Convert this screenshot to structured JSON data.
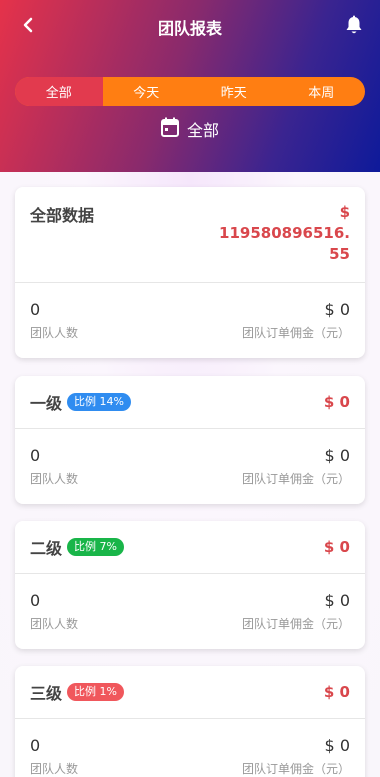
{
  "header": {
    "title": "团队报表",
    "back_icon": "chevron-left-icon",
    "bell_icon": "bell-icon"
  },
  "tabs": [
    {
      "label": "全部",
      "active": true
    },
    {
      "label": "今天",
      "active": false
    },
    {
      "label": "昨天",
      "active": false
    },
    {
      "label": "本周",
      "active": false
    }
  ],
  "date_range": {
    "icon": "calendar-icon",
    "label": "全部"
  },
  "summary": {
    "title": "全部数据",
    "amount_line1": "$",
    "amount_line2": "119580896516.",
    "amount_line3": "55",
    "members_value": "0",
    "members_label": "团队人数",
    "commission_value": "$ 0",
    "commission_label": "团队订单佣金（元）"
  },
  "levels": [
    {
      "title": "一级",
      "badge": "比例 14%",
      "badge_color": "#2f8cf0",
      "amount": "$ 0",
      "members_value": "0",
      "members_label": "团队人数",
      "commission_value": "$ 0",
      "commission_label": "团队订单佣金（元）"
    },
    {
      "title": "二级",
      "badge": "比例 7%",
      "badge_color": "#19b549",
      "amount": "$ 0",
      "members_value": "0",
      "members_label": "团队人数",
      "commission_value": "$ 0",
      "commission_label": "团队订单佣金（元）"
    },
    {
      "title": "三级",
      "badge": "比例 1%",
      "badge_color": "#f0575c",
      "amount": "$ 0",
      "members_value": "0",
      "members_label": "团队人数",
      "commission_value": "$ 0",
      "commission_label": "团队订单佣金（元）"
    }
  ],
  "colors": {
    "accent_red": "#d9474c",
    "tab_active": "#e23a4e",
    "tab_bg": "#ff7e12"
  }
}
